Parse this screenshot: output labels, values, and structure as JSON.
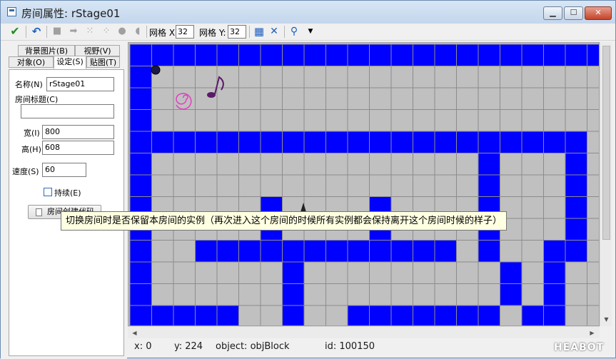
{
  "window": {
    "title": "房间属性: rStage01"
  },
  "toolbar": {
    "icons": [
      "check-icon",
      "undo-icon",
      "clear-icon",
      "shift-icon",
      "snap-icon",
      "expand-icon",
      "lock-icon",
      "unlock-icon",
      "grid-toggle-icon",
      "iso-grid-icon",
      "zoom-icon",
      "zoom-dropdown-icon"
    ],
    "grid_x_label": "网格 X:",
    "grid_x_value": "32",
    "grid_y_label": "网格 Y:",
    "grid_y_value": "32"
  },
  "tabs": {
    "row1": [
      "背景图片(B)",
      "视野(V)"
    ],
    "row2": [
      "对象(O)",
      "设定(S)",
      "贴图(T)"
    ],
    "active": "设定(S)"
  },
  "settings": {
    "name_label": "名称(N)",
    "name_value": "rStage01",
    "caption_label": "房间标题(C)",
    "caption_value": "",
    "width_label": "宽(I)",
    "width_value": "800",
    "height_label": "高(H)",
    "height_value": "608",
    "speed_label": "速度(S)",
    "speed_value": "60",
    "persistent_label": "持续(E)",
    "persistent_checked": false,
    "creation_code_label": "房间创建代码"
  },
  "tooltip": "切换房间时是否保留本房间的实例（再次进入这个房间的时候所有实例都会保持离开这个房间时候的样子）",
  "room": {
    "cell_size": 30.5,
    "colors": {
      "floor": "#c0c0c0",
      "block": "#0000ff",
      "grid": "#8c8c8c"
    },
    "rows": [
      "BBBBBBBBBBBBBBBBBBBBBB",
      "B.....................",
      "B.....................",
      "B.....................",
      "BBBBBBBBBBBBBBBBBBBBB.",
      "B...............B...B.",
      "B...............B...B.",
      "B.....B....B....B...B.",
      "B.....B....B....B...B.",
      "B..BBBBBBBBBBBB.B..BB.",
      "B......B.........B.B..",
      "B......B.........B.B..",
      "BBBBB..B..BBBBBBB.BB.."
    ],
    "instances": [
      "coin-instance",
      "spiral-instance",
      "music-note-instance",
      "spike-instance"
    ]
  },
  "status": {
    "x": "x: 0",
    "y": "y: 224",
    "object": "object: objBlock",
    "id": "id: 100150"
  },
  "watermark": "HEABOT"
}
